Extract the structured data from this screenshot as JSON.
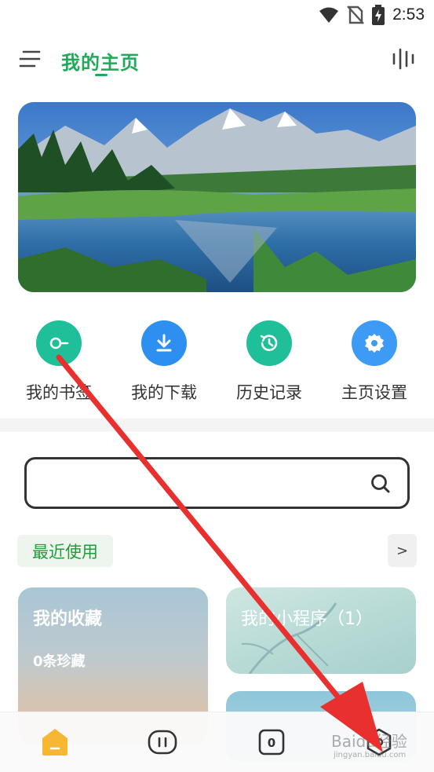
{
  "status_bar": {
    "time": "2:53",
    "icons": [
      "wifi-icon",
      "no-sim-icon",
      "battery-charging-icon"
    ]
  },
  "header": {
    "title": "我的主页",
    "icons": [
      "menu-icon",
      "voice-icon"
    ]
  },
  "quick_actions": [
    {
      "label": "我的书签",
      "icon": "bookmark-icon",
      "color": "#1fbf9a"
    },
    {
      "label": "我的下载",
      "icon": "download-icon",
      "color": "#2d8ff0"
    },
    {
      "label": "历史记录",
      "icon": "history-icon",
      "color": "#1fbf9a"
    },
    {
      "label": "主页设置",
      "icon": "gear-icon",
      "color": "#3d9bf5"
    }
  ],
  "search": {
    "placeholder": "",
    "icon": "search-icon"
  },
  "recent": {
    "label": "最近使用",
    "more": ">"
  },
  "cards": {
    "favorites": {
      "title": "我的收藏",
      "subtitle": "0条珍藏"
    },
    "mini_programs": {
      "title": "我的小程序（1）"
    }
  },
  "bottom_nav": {
    "items": [
      {
        "name": "home",
        "icon": "home-icon",
        "active": true
      },
      {
        "name": "pause",
        "icon": "pause-icon"
      },
      {
        "name": "tabs",
        "icon": "tabs-count-icon",
        "count": "0"
      },
      {
        "name": "profile",
        "icon": "hexagon-icon"
      }
    ],
    "accent": "#f7b733"
  },
  "watermark": {
    "text": "Baidu经验",
    "sub": "jingyan.baidu.com"
  },
  "colors": {
    "accent_green": "#1faa59",
    "arrow_red": "#e8302e"
  }
}
